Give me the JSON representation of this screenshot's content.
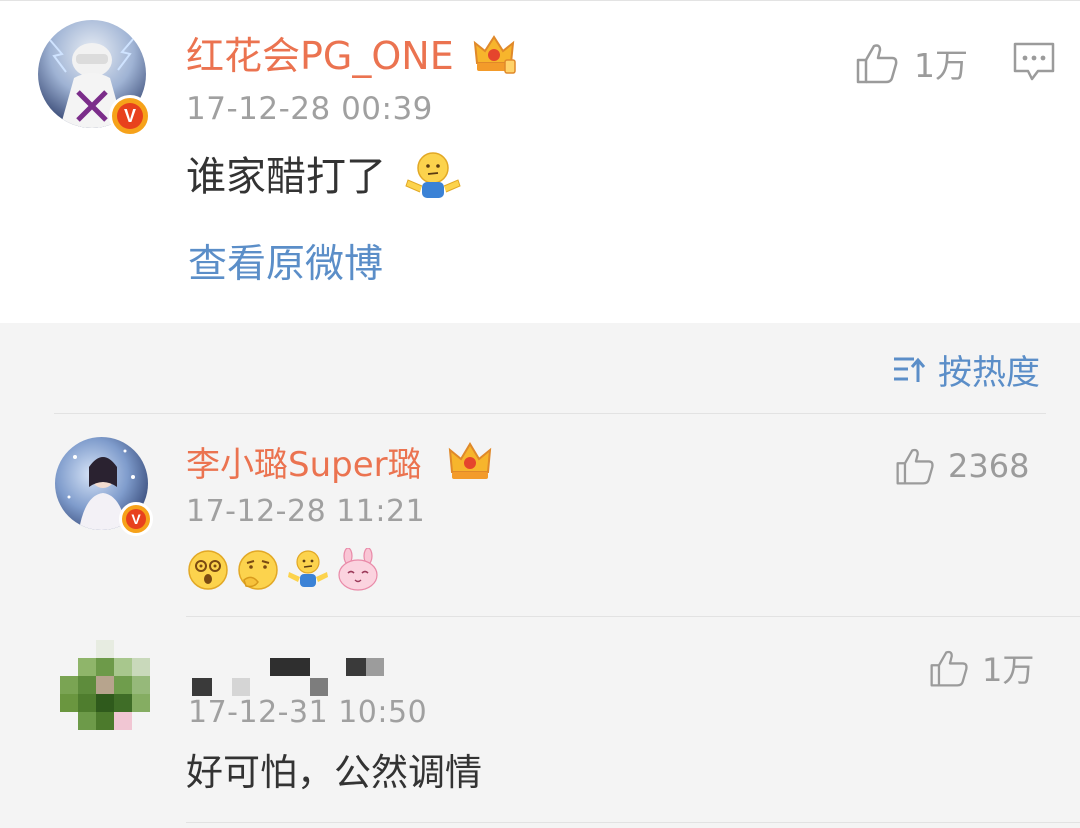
{
  "post": {
    "username": "红花会PG_ONE",
    "timestamp": "17-12-28 00:39",
    "text": "谁家醋打了",
    "like_count": "1万",
    "view_original": "查看原微博"
  },
  "sort": {
    "label": "按热度"
  },
  "comments": [
    {
      "username": "李小璐Super璐",
      "timestamp": "17-12-28 11:21",
      "like_count": "2368",
      "emojis": [
        "dizzy-face",
        "thinking-face",
        "shrug-face",
        "bunny-face"
      ]
    },
    {
      "username": "",
      "timestamp": "17-12-31 10:50",
      "like_count": "1万",
      "text": "好可怕，公然调情"
    }
  ],
  "colors": {
    "username": "#eb7350",
    "link": "#5b8ec8",
    "timestamp": "#a0a0a0",
    "background": "#f4f4f4"
  }
}
